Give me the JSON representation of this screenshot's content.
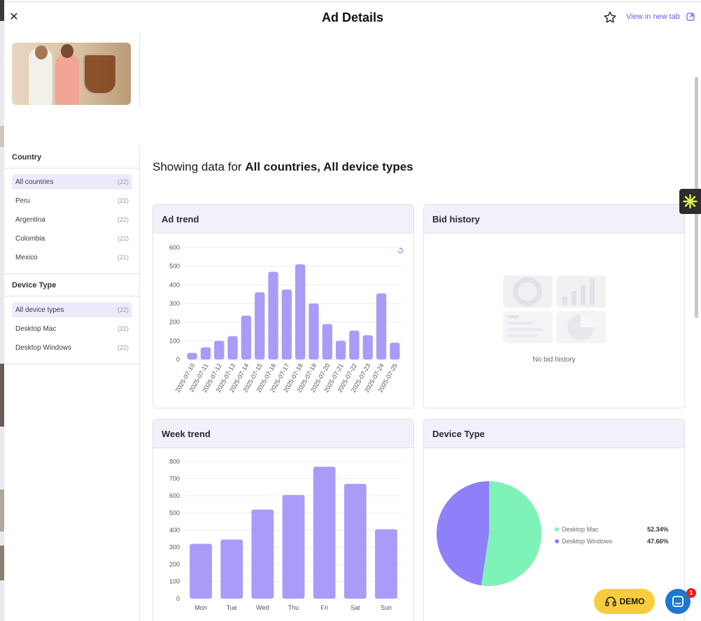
{
  "header": {
    "title": "Ad Details",
    "close_icon": "close-icon",
    "favorite_icon": "star-icon",
    "view_new_tab_label": "View in new tab",
    "external_link_icon": "external-link-icon"
  },
  "filters": {
    "country": {
      "title": "Country",
      "items": [
        {
          "label": "All countries",
          "count": "(22)",
          "selected": true
        },
        {
          "label": "Peru",
          "count": "(22)",
          "selected": false
        },
        {
          "label": "Argentina",
          "count": "(22)",
          "selected": false
        },
        {
          "label": "Colombia",
          "count": "(22)",
          "selected": false
        },
        {
          "label": "Mexico",
          "count": "(21)",
          "selected": false
        }
      ]
    },
    "device_type": {
      "title": "Device Type",
      "items": [
        {
          "label": "All device types",
          "count": "(22)",
          "selected": true
        },
        {
          "label": "Desktop Mac",
          "count": "(22)",
          "selected": false
        },
        {
          "label": "Desktop Windows",
          "count": "(22)",
          "selected": false
        }
      ]
    }
  },
  "showing": {
    "prefix": "Showing data for",
    "value": "All countries, All device types"
  },
  "cards": {
    "ad_trend_title": "Ad trend",
    "bid_history_title": "Bid history",
    "bid_history_empty": "No bid history",
    "week_trend_title": "Week trend",
    "device_type_title": "Device Type",
    "refresh_icon": "refresh-icon"
  },
  "colors": {
    "accent": "#6b5ce7",
    "bar": "#a99cf8",
    "pie_mac": "#7ff2b8",
    "pie_windows": "#8f7ff8",
    "demo": "#f8cc3c",
    "chat": "#1c77d2"
  },
  "chart_data": [
    {
      "type": "bar",
      "name": "ad_trend",
      "categories": [
        "2025-07-10",
        "2025-07-11",
        "2025-07-12",
        "2025-07-13",
        "2025-07-14",
        "2025-07-15",
        "2025-07-16",
        "2025-07-17",
        "2025-07-18",
        "2025-07-19",
        "2025-07-20",
        "2025-07-21",
        "2025-07-22",
        "2025-07-23",
        "2025-07-24",
        "2025-07-25"
      ],
      "values": [
        35,
        65,
        100,
        125,
        235,
        360,
        470,
        375,
        510,
        300,
        190,
        100,
        155,
        130,
        355,
        90
      ],
      "ylim": [
        0,
        600
      ],
      "yticks": [
        0,
        100,
        200,
        300,
        400,
        500,
        600
      ],
      "grid": true
    },
    {
      "type": "bar",
      "name": "week_trend",
      "categories": [
        "Mon",
        "Tue",
        "Wed",
        "Thu",
        "Fri",
        "Sat",
        "Sun"
      ],
      "values": [
        320,
        345,
        520,
        605,
        770,
        670,
        405
      ],
      "ylim": [
        0,
        800
      ],
      "yticks": [
        0,
        100,
        200,
        300,
        400,
        500,
        600,
        700,
        800
      ],
      "grid": true
    },
    {
      "type": "pie",
      "name": "device_type",
      "slices": [
        {
          "label": "Desktop Mac",
          "value": 52.34,
          "display": "52.34%"
        },
        {
          "label": "Desktop Windows",
          "value": 47.66,
          "display": "47.66%"
        }
      ],
      "legend": "right"
    }
  ],
  "floating": {
    "demo_label": "DEMO",
    "headset_icon": "headset-icon",
    "chat_icon": "chat-icon",
    "chat_badge": "1",
    "side_widget_icon": "sparkle-icon"
  }
}
